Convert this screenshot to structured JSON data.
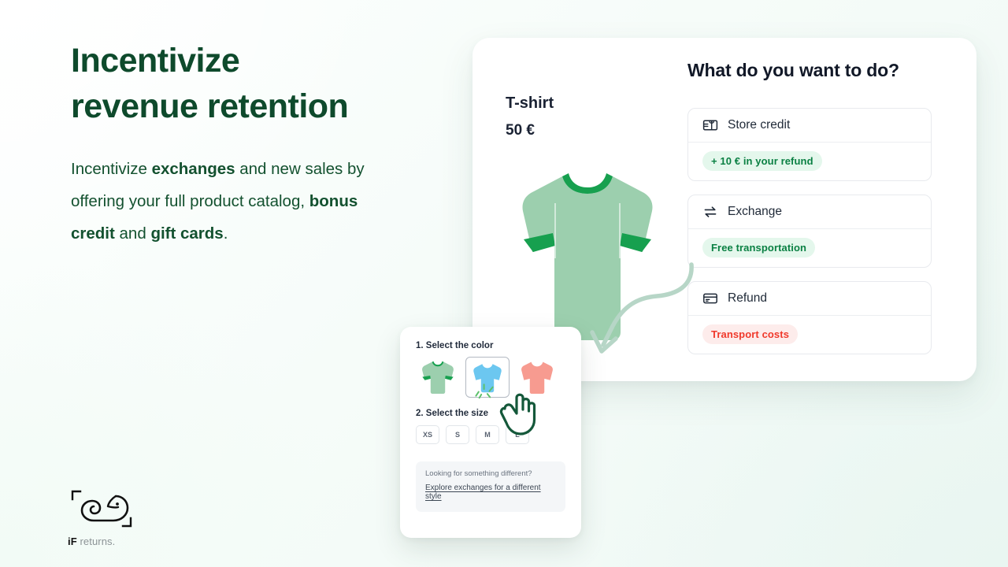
{
  "hero": {
    "headline_line1": "Incentivize",
    "headline_line2": "revenue retention",
    "paragraph_parts": [
      {
        "text": "Incentivize ",
        "bold": false
      },
      {
        "text": "exchanges",
        "bold": true
      },
      {
        "text": " and new sales by offering your full product catalog, ",
        "bold": false
      },
      {
        "text": "bonus credit",
        "bold": true
      },
      {
        "text": " and ",
        "bold": false
      },
      {
        "text": "gift cards",
        "bold": true
      },
      {
        "text": ".",
        "bold": false
      }
    ],
    "headline_color": "#0e4a2c",
    "paragraph_color": "#13512f"
  },
  "logo": {
    "brand_bold": "iF",
    "brand_rest": " returns.",
    "mark_name": "chameleon-logo-mark"
  },
  "main_card": {
    "product": {
      "name": "T-shirt",
      "price": "50 €",
      "image_name": "green-tshirt-illustration",
      "color_fill": "#9ccfae",
      "trim_color": "#17a04f"
    },
    "panel_title": "What do you want to do?",
    "options": [
      {
        "icon": "gift-card-icon",
        "label": "Store credit",
        "badge": "+ 10 € in your refund",
        "badge_kind": "green"
      },
      {
        "icon": "exchange-arrows-icon",
        "label": "Exchange",
        "badge": "Free transportation",
        "badge_kind": "green"
      },
      {
        "icon": "credit-card-icon",
        "label": "Refund",
        "badge": "Transport costs",
        "badge_kind": "red"
      }
    ],
    "badge_colors": {
      "green_bg": "#e4f7ec",
      "green_text": "#0a8043",
      "red_bg": "#fdeceb",
      "red_text": "#f0392b"
    }
  },
  "popup": {
    "step1_title": "1. Select the color",
    "colors": [
      {
        "name": "green-tshirt-swatch",
        "fill": "#9ccfae",
        "trim": "#17a04f",
        "selected": false
      },
      {
        "name": "blue-tshirt-swatch",
        "fill": "#6cc7f0",
        "trim": "#6cc7f0",
        "selected": true
      },
      {
        "name": "pink-tshirt-swatch",
        "fill": "#f79b90",
        "trim": "#f79b90",
        "selected": false
      }
    ],
    "step2_title": "2. Select the size",
    "sizes": [
      "XS",
      "S",
      "M",
      "L"
    ],
    "note_question": "Looking for something different?",
    "note_link": "Explore  exchanges for a different style",
    "cursor_name": "hand-cursor-icon"
  },
  "arrow": {
    "name": "curved-arrow-connector",
    "color": "#b7d6c7"
  }
}
